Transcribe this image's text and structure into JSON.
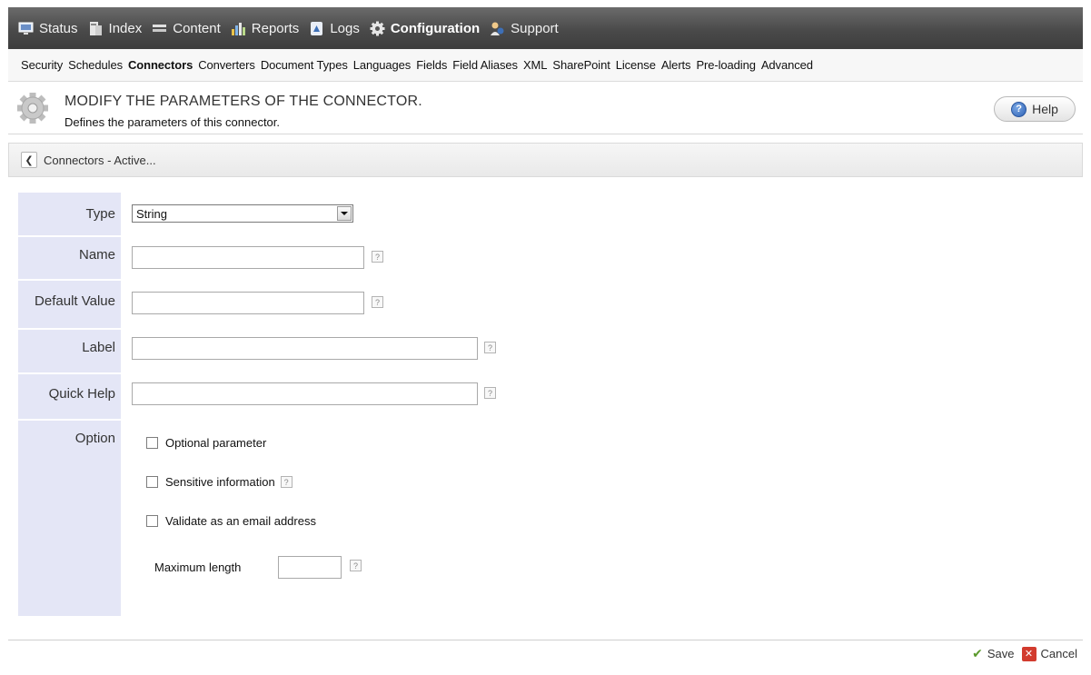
{
  "top_nav": {
    "items": [
      {
        "label": "Status",
        "icon": "monitor-icon"
      },
      {
        "label": "Index",
        "icon": "server-icon"
      },
      {
        "label": "Content",
        "icon": "content-icon"
      },
      {
        "label": "Reports",
        "icon": "bar-chart-icon"
      },
      {
        "label": "Logs",
        "icon": "log-icon"
      },
      {
        "label": "Configuration",
        "icon": "gear-icon",
        "active": true
      },
      {
        "label": "Support",
        "icon": "support-icon"
      }
    ]
  },
  "sub_nav": {
    "items": [
      "Security",
      "Schedules",
      "Connectors",
      "Converters",
      "Document Types",
      "Languages",
      "Fields",
      "Field Aliases",
      "XML",
      "SharePoint",
      "License",
      "Alerts",
      "Pre-loading",
      "Advanced"
    ],
    "active": "Connectors"
  },
  "header": {
    "title": "MODIFY THE PARAMETERS OF THE CONNECTOR.",
    "subtitle": "Defines the parameters of this connector.",
    "help_label": "Help"
  },
  "breadcrumb": {
    "text": "Connectors - Active..."
  },
  "form": {
    "type_label": "Type",
    "type_value": "String",
    "name_label": "Name",
    "name_value": "",
    "default_label": "Default Value",
    "default_value": "",
    "label_label": "Label",
    "label_value": "",
    "quickhelp_label": "Quick Help",
    "quickhelp_value": "",
    "option_label": "Option",
    "options": {
      "optional": {
        "label": "Optional parameter",
        "checked": false
      },
      "sensitive": {
        "label": "Sensitive information",
        "checked": false
      },
      "validate_email": {
        "label": "Validate as an email address",
        "checked": false
      }
    },
    "maxlen_label": "Maximum length",
    "maxlen_value": "",
    "help_glyph": "?"
  },
  "footer": {
    "save_label": "Save",
    "cancel_label": "Cancel"
  },
  "colors": {
    "topbar": "#4a4a4a",
    "label_column": "#e4e6f6",
    "save_check": "#5b9a2c",
    "cancel_red": "#d23b2e"
  }
}
